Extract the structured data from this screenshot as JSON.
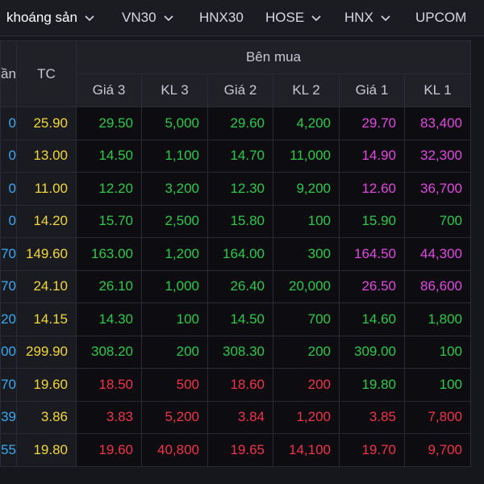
{
  "tabs": [
    {
      "label": "khoáng sản",
      "has_dropdown": true,
      "active": true
    },
    {
      "label": "VN30",
      "has_dropdown": true,
      "active": false
    },
    {
      "label": "HNX30",
      "has_dropdown": false,
      "active": false
    },
    {
      "label": "HOSE",
      "has_dropdown": true,
      "active": false
    },
    {
      "label": "HNX",
      "has_dropdown": true,
      "active": false
    },
    {
      "label": "UPCOM",
      "has_dropdown": false,
      "active": false
    }
  ],
  "table": {
    "cut_header": "ần",
    "tc_header": "TC",
    "group_header": "Bên mua",
    "sub_headers": [
      "Giá 3",
      "KL 3",
      "Giá 2",
      "KL 2",
      "Giá 1",
      "KL 1"
    ],
    "rows": [
      {
        "cut": "0",
        "cut_color": "cut",
        "tc": "25.90",
        "cells": [
          [
            "29.50",
            "up"
          ],
          [
            "5,000",
            "up"
          ],
          [
            "29.60",
            "up"
          ],
          [
            "4,200",
            "up"
          ],
          [
            "29.70",
            "ceil"
          ],
          [
            "83,400",
            "ceil"
          ]
        ]
      },
      {
        "cut": "0",
        "cut_color": "cut",
        "tc": "13.00",
        "cells": [
          [
            "14.50",
            "up"
          ],
          [
            "1,100",
            "up"
          ],
          [
            "14.70",
            "up"
          ],
          [
            "11,000",
            "up"
          ],
          [
            "14.90",
            "ceil"
          ],
          [
            "32,300",
            "ceil"
          ]
        ]
      },
      {
        "cut": "0",
        "cut_color": "cut",
        "tc": "11.00",
        "cells": [
          [
            "12.20",
            "up"
          ],
          [
            "3,200",
            "up"
          ],
          [
            "12.30",
            "up"
          ],
          [
            "9,200",
            "up"
          ],
          [
            "12.60",
            "ceil"
          ],
          [
            "36,700",
            "ceil"
          ]
        ]
      },
      {
        "cut": "0",
        "cut_color": "cut",
        "tc": "14.20",
        "cells": [
          [
            "15.70",
            "up"
          ],
          [
            "2,500",
            "up"
          ],
          [
            "15.80",
            "up"
          ],
          [
            "100",
            "up"
          ],
          [
            "15.90",
            "up"
          ],
          [
            "700",
            "up"
          ]
        ]
      },
      {
        "cut": "70",
        "cut_color": "cut",
        "tc": "149.60",
        "cells": [
          [
            "163.00",
            "up"
          ],
          [
            "1,200",
            "up"
          ],
          [
            "164.00",
            "up"
          ],
          [
            "300",
            "up"
          ],
          [
            "164.50",
            "ceil"
          ],
          [
            "44,300",
            "ceil"
          ]
        ]
      },
      {
        "cut": "70",
        "cut_color": "cut",
        "tc": "24.10",
        "cells": [
          [
            "26.10",
            "up"
          ],
          [
            "1,000",
            "up"
          ],
          [
            "26.40",
            "up"
          ],
          [
            "20,000",
            "up"
          ],
          [
            "26.50",
            "ceil"
          ],
          [
            "86,600",
            "ceil"
          ]
        ]
      },
      {
        "cut": "20",
        "cut_color": "cut",
        "tc": "14.15",
        "cells": [
          [
            "14.30",
            "up"
          ],
          [
            "100",
            "up"
          ],
          [
            "14.50",
            "up"
          ],
          [
            "700",
            "up"
          ],
          [
            "14.60",
            "up"
          ],
          [
            "1,800",
            "up"
          ]
        ]
      },
      {
        "cut": "00",
        "cut_color": "cut",
        "tc": "299.90",
        "cells": [
          [
            "308.20",
            "up"
          ],
          [
            "200",
            "up"
          ],
          [
            "308.30",
            "up"
          ],
          [
            "200",
            "up"
          ],
          [
            "309.00",
            "up"
          ],
          [
            "100",
            "up"
          ]
        ]
      },
      {
        "cut": "70",
        "cut_color": "cut",
        "tc": "19.60",
        "cells": [
          [
            "18.50",
            "down"
          ],
          [
            "500",
            "down"
          ],
          [
            "18.60",
            "down"
          ],
          [
            "200",
            "down"
          ],
          [
            "19.80",
            "up"
          ],
          [
            "100",
            "up"
          ]
        ]
      },
      {
        "cut": "39",
        "cut_color": "cut",
        "tc": "3.86",
        "cells": [
          [
            "3.83",
            "down"
          ],
          [
            "5,200",
            "down"
          ],
          [
            "3.84",
            "down"
          ],
          [
            "1,200",
            "down"
          ],
          [
            "3.85",
            "down"
          ],
          [
            "7,800",
            "down"
          ]
        ]
      },
      {
        "cut": "55",
        "cut_color": "cut",
        "tc": "19.80",
        "cells": [
          [
            "19.60",
            "down"
          ],
          [
            "40,800",
            "down"
          ],
          [
            "19.65",
            "down"
          ],
          [
            "14,100",
            "down"
          ],
          [
            "19.70",
            "down"
          ],
          [
            "9,700",
            "down"
          ]
        ]
      }
    ]
  },
  "colors": {
    "up": "#2ec94a",
    "ceil": "#e04adf",
    "down": "#f0344a",
    "reference": "#f2d73a",
    "cut": "#3aa8f2"
  },
  "icons": {
    "tab_dropdown": "chevron-down-icon"
  }
}
